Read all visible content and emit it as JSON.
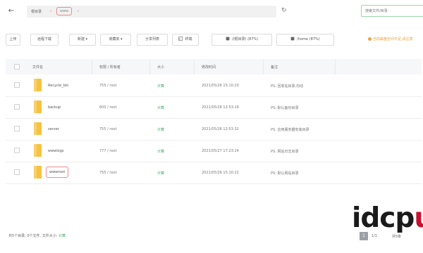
{
  "address_bar": {
    "root": "根目录",
    "separator": "›",
    "current": "www",
    "trailing_separator": "›"
  },
  "search": {
    "placeholder": "搜索文件/目录"
  },
  "toolbar": {
    "buttons": [
      {
        "label": "上传"
      },
      {
        "label": "远程下载"
      },
      {
        "label": "新建 ▾"
      },
      {
        "label": "收藏夹 ▾"
      },
      {
        "label": "分享列表"
      },
      {
        "label": "终端"
      },
      {
        "label": "/(根目录) (87%)"
      },
      {
        "label": "/home (87%)"
      }
    ],
    "notice": "当前磁盘空间不足,请注意"
  },
  "table": {
    "headers": {
      "name": "文件名",
      "perm": "权限 / 所有者",
      "size": "大小",
      "mtime": "修改时间",
      "remark": "备注"
    },
    "rows": [
      {
        "name": "Recycle_bin",
        "perm": "755 / root",
        "size": "计算",
        "mtime": "2021/05/26 15:10:20",
        "remark": "PS: 回收站目录,勿动"
      },
      {
        "name": "backup",
        "perm": "600 / root",
        "size": "计算",
        "mtime": "2021/05/26 12:53:16",
        "remark": "PS: 默认备份目录"
      },
      {
        "name": "server",
        "perm": "755 / root",
        "size": "计算",
        "mtime": "2021/05/26 12:53:32",
        "remark": "PS: 应用服务器安装目录"
      },
      {
        "name": "wwwlogs",
        "perm": "777 / root",
        "size": "计算",
        "mtime": "2021/05/27 17:23:14",
        "remark": "PS: 网站日志目录"
      },
      {
        "name": "wwwroot",
        "perm": "755 / root",
        "size": "计算",
        "mtime": "2021/05/26 15:10:22",
        "remark": "PS: 默认网站目录"
      }
    ]
  },
  "footer": {
    "stat_prefix": "共5个目录, 0个文件, 文件大小:",
    "stat_link": "计算",
    "watermark_main": "idcp",
    "watermark_accent": "u",
    "page_current": "1",
    "page_total": "1/1",
    "page_count": "共5条"
  },
  "colors": {
    "highlight_border": "#e98c8c",
    "folder": "#f5c242",
    "size_link": "#3ca55c",
    "notice": "#e6a23c",
    "search_border": "#9ad6a5",
    "watermark_red": "#c8102e"
  }
}
